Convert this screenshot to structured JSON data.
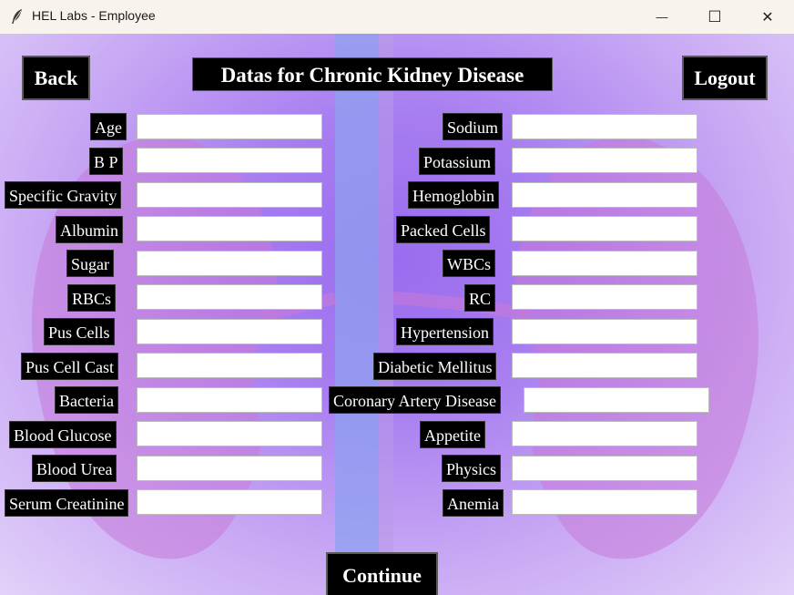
{
  "window": {
    "title": "HEL Labs - Employee",
    "minimize_glyph": "—",
    "maximize_glyph": "☐",
    "close_glyph": "✕"
  },
  "header": {
    "back_label": "Back",
    "title": "Datas for Chronic Kidney Disease",
    "logout_label": "Logout"
  },
  "left_fields": [
    {
      "label": "Age",
      "value": ""
    },
    {
      "label": "B P",
      "value": ""
    },
    {
      "label": "Specific Gravity",
      "value": ""
    },
    {
      "label": "Albumin",
      "value": ""
    },
    {
      "label": "Sugar",
      "value": ""
    },
    {
      "label": "RBCs",
      "value": ""
    },
    {
      "label": "Pus Cells",
      "value": ""
    },
    {
      "label": "Pus Cell Cast",
      "value": ""
    },
    {
      "label": "Bacteria",
      "value": ""
    },
    {
      "label": "Blood Glucose",
      "value": ""
    },
    {
      "label": "Blood Urea",
      "value": ""
    },
    {
      "label": "Serum Creatinine",
      "value": ""
    }
  ],
  "right_fields": [
    {
      "label": "Sodium",
      "value": ""
    },
    {
      "label": "Potassium",
      "value": ""
    },
    {
      "label": "Hemoglobin",
      "value": ""
    },
    {
      "label": "Packed Cells",
      "value": ""
    },
    {
      "label": "WBCs",
      "value": ""
    },
    {
      "label": "RC",
      "value": ""
    },
    {
      "label": "Hypertension",
      "value": ""
    },
    {
      "label": "Diabetic Mellitus",
      "value": ""
    },
    {
      "label": "Coronary Artery Disease",
      "value": ""
    },
    {
      "label": "Appetite",
      "value": ""
    },
    {
      "label": "Physics",
      "value": ""
    },
    {
      "label": "Anemia",
      "value": ""
    }
  ],
  "footer": {
    "continue_label": "Continue"
  },
  "colors": {
    "label_bg": "#000000",
    "label_text": "#ffffff",
    "background_accent": "#9a6cf0"
  }
}
